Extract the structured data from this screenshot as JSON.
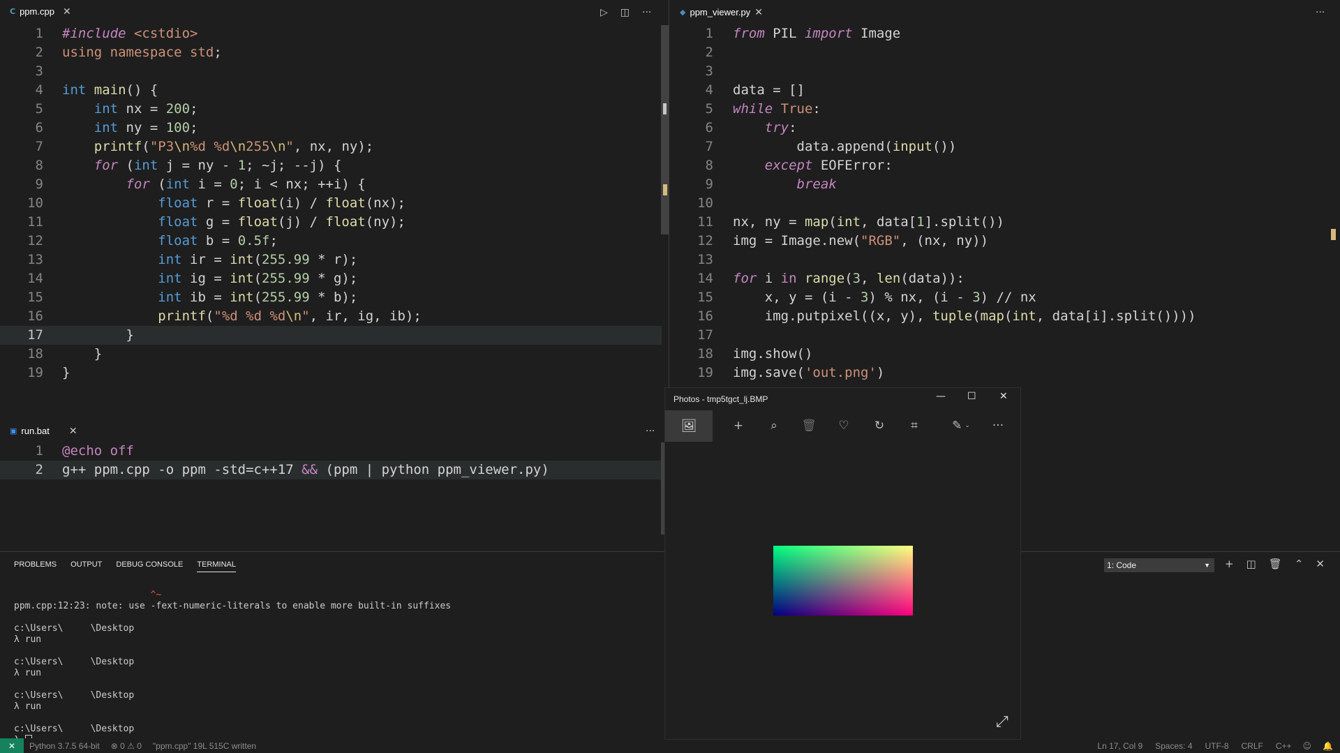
{
  "editor_left": {
    "tab": {
      "icon": "C",
      "label": "ppm.cpp"
    },
    "lines": [
      {
        "n": "1",
        "parts": [
          [
            "prep",
            "#include "
          ],
          [
            "str",
            "<cstdio>"
          ]
        ]
      },
      {
        "n": "2",
        "parts": [
          [
            "str",
            "using "
          ],
          [
            "str",
            "namespace "
          ],
          [
            "str",
            "std"
          ],
          [
            "op",
            ";"
          ]
        ]
      },
      {
        "n": "3",
        "parts": []
      },
      {
        "n": "4",
        "parts": [
          [
            "ty",
            "int "
          ],
          [
            "fn",
            "main"
          ],
          [
            "op",
            "() {"
          ]
        ]
      },
      {
        "n": "5",
        "parts": [
          [
            "op",
            "    "
          ],
          [
            "ty",
            "int "
          ],
          [
            "op",
            "nx = "
          ],
          [
            "num",
            "200"
          ],
          [
            "op",
            ";"
          ]
        ]
      },
      {
        "n": "6",
        "parts": [
          [
            "op",
            "    "
          ],
          [
            "ty",
            "int "
          ],
          [
            "op",
            "ny = "
          ],
          [
            "num",
            "100"
          ],
          [
            "op",
            ";"
          ]
        ]
      },
      {
        "n": "7",
        "parts": [
          [
            "op",
            "    "
          ],
          [
            "fn",
            "printf"
          ],
          [
            "op",
            "("
          ],
          [
            "str",
            "\"P3"
          ],
          [
            "esc",
            "\\n"
          ],
          [
            "str",
            "%d %d"
          ],
          [
            "esc",
            "\\n"
          ],
          [
            "str",
            "255"
          ],
          [
            "esc",
            "\\n"
          ],
          [
            "str",
            "\""
          ],
          [
            "op",
            ", nx, ny);"
          ]
        ]
      },
      {
        "n": "8",
        "parts": [
          [
            "op",
            "    "
          ],
          [
            "kwi",
            "for "
          ],
          [
            "op",
            "("
          ],
          [
            "ty",
            "int "
          ],
          [
            "op",
            "j = ny - "
          ],
          [
            "num",
            "1"
          ],
          [
            "op",
            "; ~j; --j) {"
          ]
        ]
      },
      {
        "n": "9",
        "parts": [
          [
            "op",
            "        "
          ],
          [
            "kwi",
            "for "
          ],
          [
            "op",
            "("
          ],
          [
            "ty",
            "int "
          ],
          [
            "op",
            "i = "
          ],
          [
            "num",
            "0"
          ],
          [
            "op",
            "; i < nx; ++i) {"
          ]
        ]
      },
      {
        "n": "10",
        "parts": [
          [
            "op",
            "            "
          ],
          [
            "ty",
            "float "
          ],
          [
            "op",
            "r = "
          ],
          [
            "fn",
            "float"
          ],
          [
            "op",
            "(i) / "
          ],
          [
            "fn",
            "float"
          ],
          [
            "op",
            "(nx);"
          ]
        ]
      },
      {
        "n": "11",
        "parts": [
          [
            "op",
            "            "
          ],
          [
            "ty",
            "float "
          ],
          [
            "op",
            "g = "
          ],
          [
            "fn",
            "float"
          ],
          [
            "op",
            "(j) / "
          ],
          [
            "fn",
            "float"
          ],
          [
            "op",
            "(ny);"
          ]
        ]
      },
      {
        "n": "12",
        "parts": [
          [
            "op",
            "            "
          ],
          [
            "ty",
            "float "
          ],
          [
            "op",
            "b = "
          ],
          [
            "num",
            "0.5f"
          ],
          [
            "op",
            ";"
          ]
        ]
      },
      {
        "n": "13",
        "parts": [
          [
            "op",
            "            "
          ],
          [
            "ty",
            "int "
          ],
          [
            "op",
            "ir = "
          ],
          [
            "fn",
            "int"
          ],
          [
            "op",
            "("
          ],
          [
            "num",
            "255.99"
          ],
          [
            "op",
            " * r);"
          ]
        ]
      },
      {
        "n": "14",
        "parts": [
          [
            "op",
            "            "
          ],
          [
            "ty",
            "int "
          ],
          [
            "op",
            "ig = "
          ],
          [
            "fn",
            "int"
          ],
          [
            "op",
            "("
          ],
          [
            "num",
            "255.99"
          ],
          [
            "op",
            " * g);"
          ]
        ]
      },
      {
        "n": "15",
        "parts": [
          [
            "op",
            "            "
          ],
          [
            "ty",
            "int "
          ],
          [
            "op",
            "ib = "
          ],
          [
            "fn",
            "int"
          ],
          [
            "op",
            "("
          ],
          [
            "num",
            "255.99"
          ],
          [
            "op",
            " * b);"
          ]
        ]
      },
      {
        "n": "16",
        "parts": [
          [
            "op",
            "            "
          ],
          [
            "fn",
            "printf"
          ],
          [
            "op",
            "("
          ],
          [
            "str",
            "\"%d %d %d"
          ],
          [
            "esc",
            "\\n"
          ],
          [
            "str",
            "\""
          ],
          [
            "op",
            ", ir, ig, ib);"
          ]
        ]
      },
      {
        "n": "17",
        "parts": [
          [
            "op",
            "        }"
          ]
        ]
      },
      {
        "n": "18",
        "parts": [
          [
            "op",
            "    }"
          ]
        ]
      },
      {
        "n": "19",
        "parts": [
          [
            "op",
            "}"
          ]
        ]
      }
    ]
  },
  "editor_right": {
    "tab": {
      "icon": "◆",
      "label": "ppm_viewer.py"
    },
    "lines": [
      {
        "n": "1",
        "parts": [
          [
            "kwi",
            "from "
          ],
          [
            "op",
            "PIL "
          ],
          [
            "kwi",
            "import "
          ],
          [
            "op",
            "Image"
          ]
        ]
      },
      {
        "n": "2",
        "parts": []
      },
      {
        "n": "3",
        "parts": []
      },
      {
        "n": "4",
        "parts": [
          [
            "op",
            "data = []"
          ]
        ]
      },
      {
        "n": "5",
        "parts": [
          [
            "kwi",
            "while "
          ],
          [
            "str",
            "True"
          ],
          [
            "op",
            ":"
          ]
        ]
      },
      {
        "n": "6",
        "parts": [
          [
            "op",
            "    "
          ],
          [
            "kwi",
            "try"
          ],
          [
            "op",
            ":"
          ]
        ]
      },
      {
        "n": "7",
        "parts": [
          [
            "op",
            "        data.append("
          ],
          [
            "fn",
            "input"
          ],
          [
            "op",
            "())"
          ]
        ]
      },
      {
        "n": "8",
        "parts": [
          [
            "op",
            "    "
          ],
          [
            "kwi",
            "except "
          ],
          [
            "op",
            "EOFError:"
          ]
        ]
      },
      {
        "n": "9",
        "parts": [
          [
            "op",
            "        "
          ],
          [
            "kwi",
            "break"
          ]
        ]
      },
      {
        "n": "10",
        "parts": []
      },
      {
        "n": "11",
        "parts": [
          [
            "op",
            "nx, ny = "
          ],
          [
            "fn",
            "map"
          ],
          [
            "op",
            "("
          ],
          [
            "fn",
            "int"
          ],
          [
            "op",
            ", data["
          ],
          [
            "num",
            "1"
          ],
          [
            "op",
            "].split())"
          ]
        ]
      },
      {
        "n": "12",
        "parts": [
          [
            "op",
            "img = Image.new("
          ],
          [
            "str",
            "\"RGB\""
          ],
          [
            "op",
            ", (nx, ny))"
          ]
        ]
      },
      {
        "n": "13",
        "parts": []
      },
      {
        "n": "14",
        "parts": [
          [
            "kwi",
            "for "
          ],
          [
            "op",
            "i "
          ],
          [
            "kw",
            "in "
          ],
          [
            "fn",
            "range"
          ],
          [
            "op",
            "("
          ],
          [
            "num",
            "3"
          ],
          [
            "op",
            ", "
          ],
          [
            "fn",
            "len"
          ],
          [
            "op",
            "(data)):"
          ]
        ]
      },
      {
        "n": "15",
        "parts": [
          [
            "op",
            "    x, y = (i - "
          ],
          [
            "num",
            "3"
          ],
          [
            "op",
            ") % nx, (i - "
          ],
          [
            "num",
            "3"
          ],
          [
            "op",
            ") // nx"
          ]
        ]
      },
      {
        "n": "16",
        "parts": [
          [
            "op",
            "    img.putpixel((x, y), "
          ],
          [
            "fn",
            "tuple"
          ],
          [
            "op",
            "("
          ],
          [
            "fn",
            "map"
          ],
          [
            "op",
            "("
          ],
          [
            "fn",
            "int"
          ],
          [
            "op",
            ", data[i].split())))"
          ]
        ]
      },
      {
        "n": "17",
        "parts": []
      },
      {
        "n": "18",
        "parts": [
          [
            "op",
            "img.show()"
          ]
        ]
      },
      {
        "n": "19",
        "parts": [
          [
            "op",
            "img.save("
          ],
          [
            "str",
            "'out.png'"
          ],
          [
            "op",
            ")"
          ]
        ]
      }
    ]
  },
  "editor_bottom": {
    "tab": {
      "icon": "▣",
      "label": "run.bat"
    },
    "lines": [
      {
        "n": "1",
        "parts": [
          [
            "kw",
            "@echo off"
          ]
        ]
      },
      {
        "n": "2",
        "parts": [
          [
            "op",
            "g++ ppm.cpp -o ppm -std=c++17 "
          ],
          [
            "kw",
            "&& "
          ],
          [
            "op",
            "(ppm | python ppm_viewer.py)"
          ]
        ]
      }
    ]
  },
  "tab_actions": {
    "run": "▷",
    "split": "◫",
    "more": "···"
  },
  "panel": {
    "tabs": [
      "PROBLEMS",
      "OUTPUT",
      "DEBUG CONSOLE",
      "TERMINAL"
    ],
    "active_tab": "TERMINAL",
    "terminal_select": "1: Code",
    "terminal_lines": [
      "                         ^~",
      "ppm.cpp:12:23: note: use -fext-numeric-literals to enable more built-in suffixes",
      "",
      "c:\\Users\\     \\Desktop",
      "λ run",
      "",
      "c:\\Users\\     \\Desktop",
      "λ run",
      "",
      "c:\\Users\\     \\Desktop",
      "λ run",
      "",
      "c:\\Users\\     \\Desktop",
      "λ "
    ]
  },
  "photos": {
    "title": "Photos - tmp5tgct_lj.BMP",
    "image_colors": {
      "top_left": "#00ff80",
      "top_right": "#ffff80",
      "bottom_left": "#000080",
      "bottom_right": "#ff0080"
    }
  },
  "status": {
    "python": "Python 3.7.5 64-bit",
    "problems": "⊗ 0 ⚠ 0",
    "message": "\"ppm.cpp\" 19L 515C written",
    "position": "Ln 17, Col 9",
    "spaces": "Spaces: 4",
    "encoding": "UTF-8",
    "eol": "CRLF",
    "language": "C++"
  }
}
